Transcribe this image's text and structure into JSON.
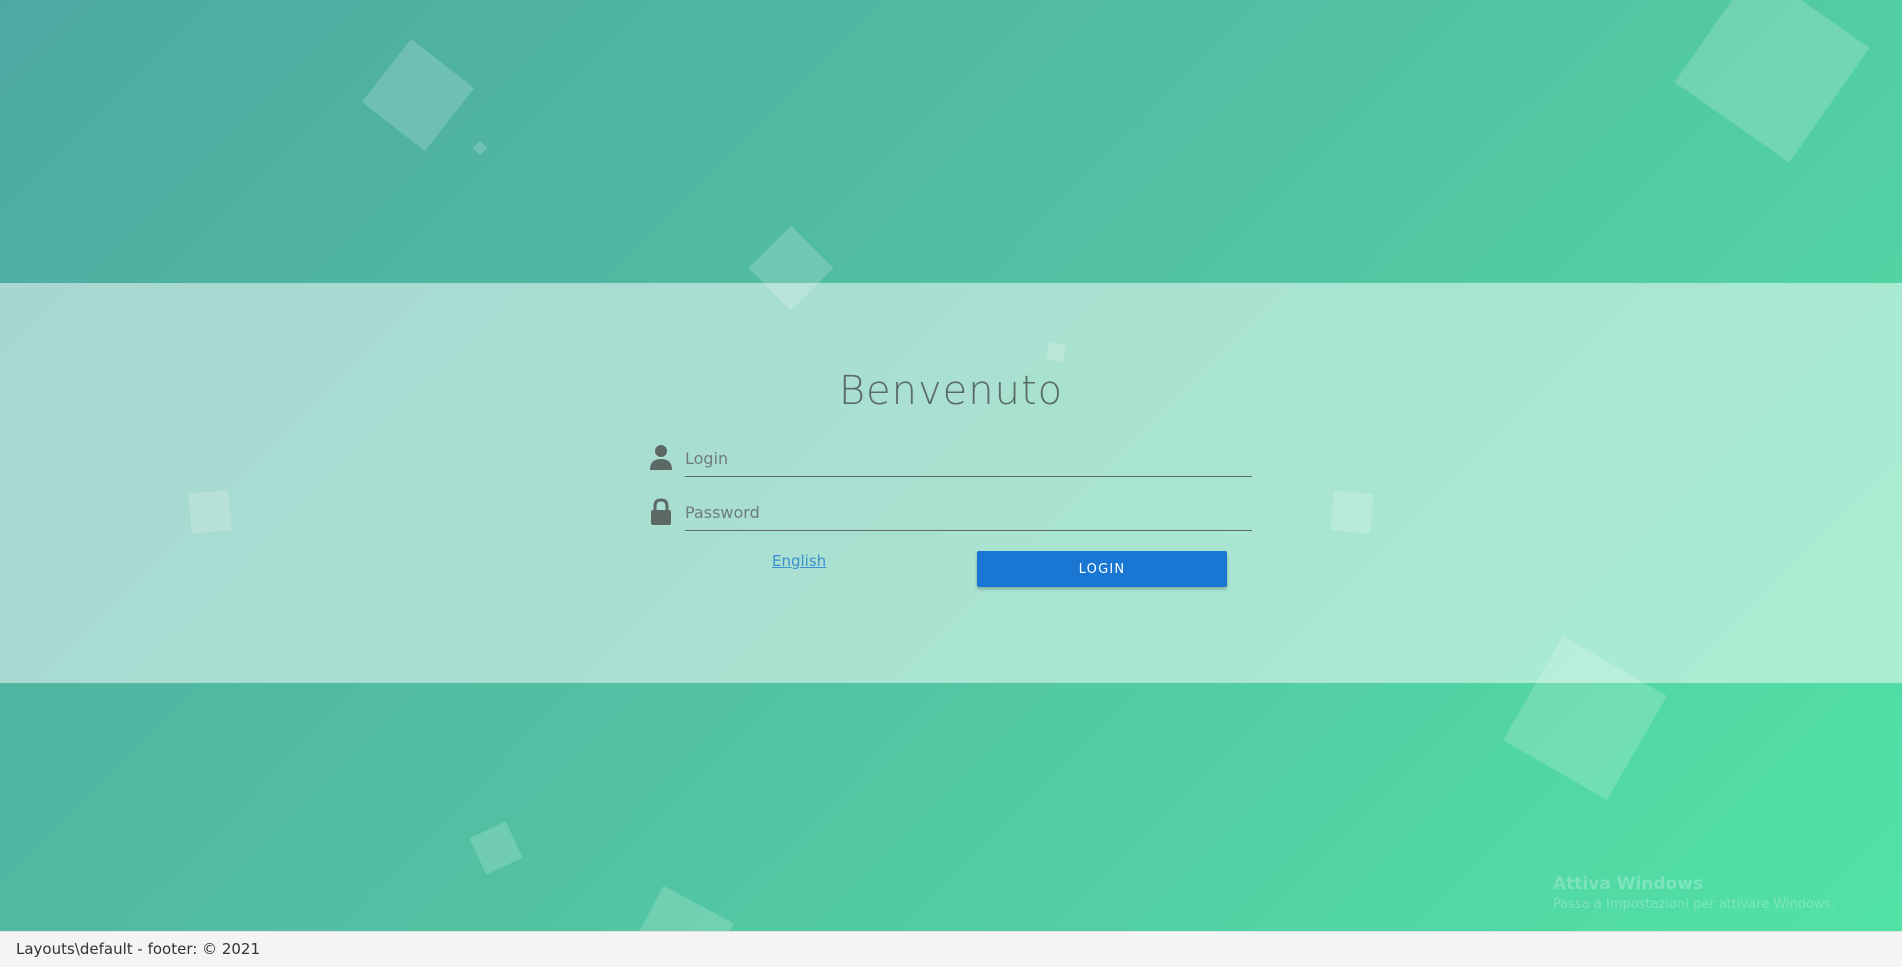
{
  "colors": {
    "gradient_start": "#4ea9a2",
    "gradient_end": "#52e2a6",
    "button": "#1976d2",
    "link": "#3b8fd1"
  },
  "login_form": {
    "title": "Benvenuto",
    "login_field": {
      "icon": "user-icon",
      "placeholder": "Login",
      "value": ""
    },
    "password_field": {
      "icon": "lock-icon",
      "placeholder": "Password",
      "value": ""
    },
    "language_link": "English",
    "submit_label": "LOGIN"
  },
  "watermark": {
    "title": "Attiva Windows",
    "subtitle": "Passa a Impostazioni per attivare Windows."
  },
  "footer": {
    "text": "Layouts\\default - footer: © 2021"
  }
}
